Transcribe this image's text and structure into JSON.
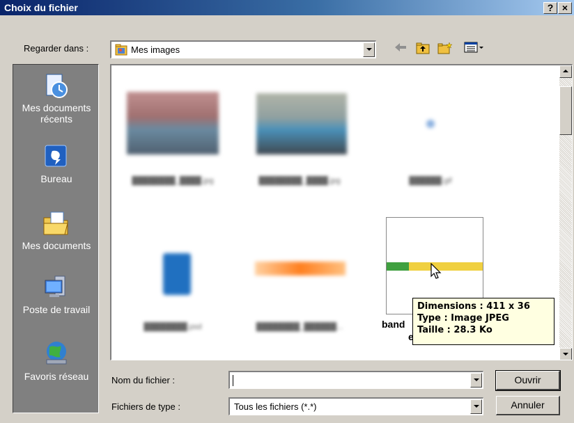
{
  "window": {
    "title": "Choix du fichier",
    "help_button": "?",
    "close_button": "×"
  },
  "lookin": {
    "label": "Regarder dans :",
    "value": "Mes images"
  },
  "toolbar": {
    "icons": [
      "back-arrow-icon",
      "up-folder-icon",
      "new-folder-icon",
      "view-menu-icon"
    ]
  },
  "places": [
    {
      "label": "Mes documents récents",
      "icon": "recent-documents-icon"
    },
    {
      "label": "Bureau",
      "icon": "desktop-icon"
    },
    {
      "label": "Mes documents",
      "icon": "my-documents-icon"
    },
    {
      "label": "Poste de travail",
      "icon": "my-computer-icon"
    },
    {
      "label": "Favoris réseau",
      "icon": "network-places-icon"
    }
  ],
  "files": {
    "selected_caption_partial": "band",
    "selected_caption_line2": "e"
  },
  "tooltip": {
    "dimensions": "Dimensions : 411 x 36",
    "type": "Type : Image JPEG",
    "size": "Taille : 28.3 Ko"
  },
  "filename": {
    "label": "Nom du fichier :",
    "value": ""
  },
  "filetype": {
    "label": "Fichiers de type :",
    "value": "Tous les fichiers (*.*)"
  },
  "buttons": {
    "open": "Ouvrir",
    "cancel": "Annuler"
  }
}
